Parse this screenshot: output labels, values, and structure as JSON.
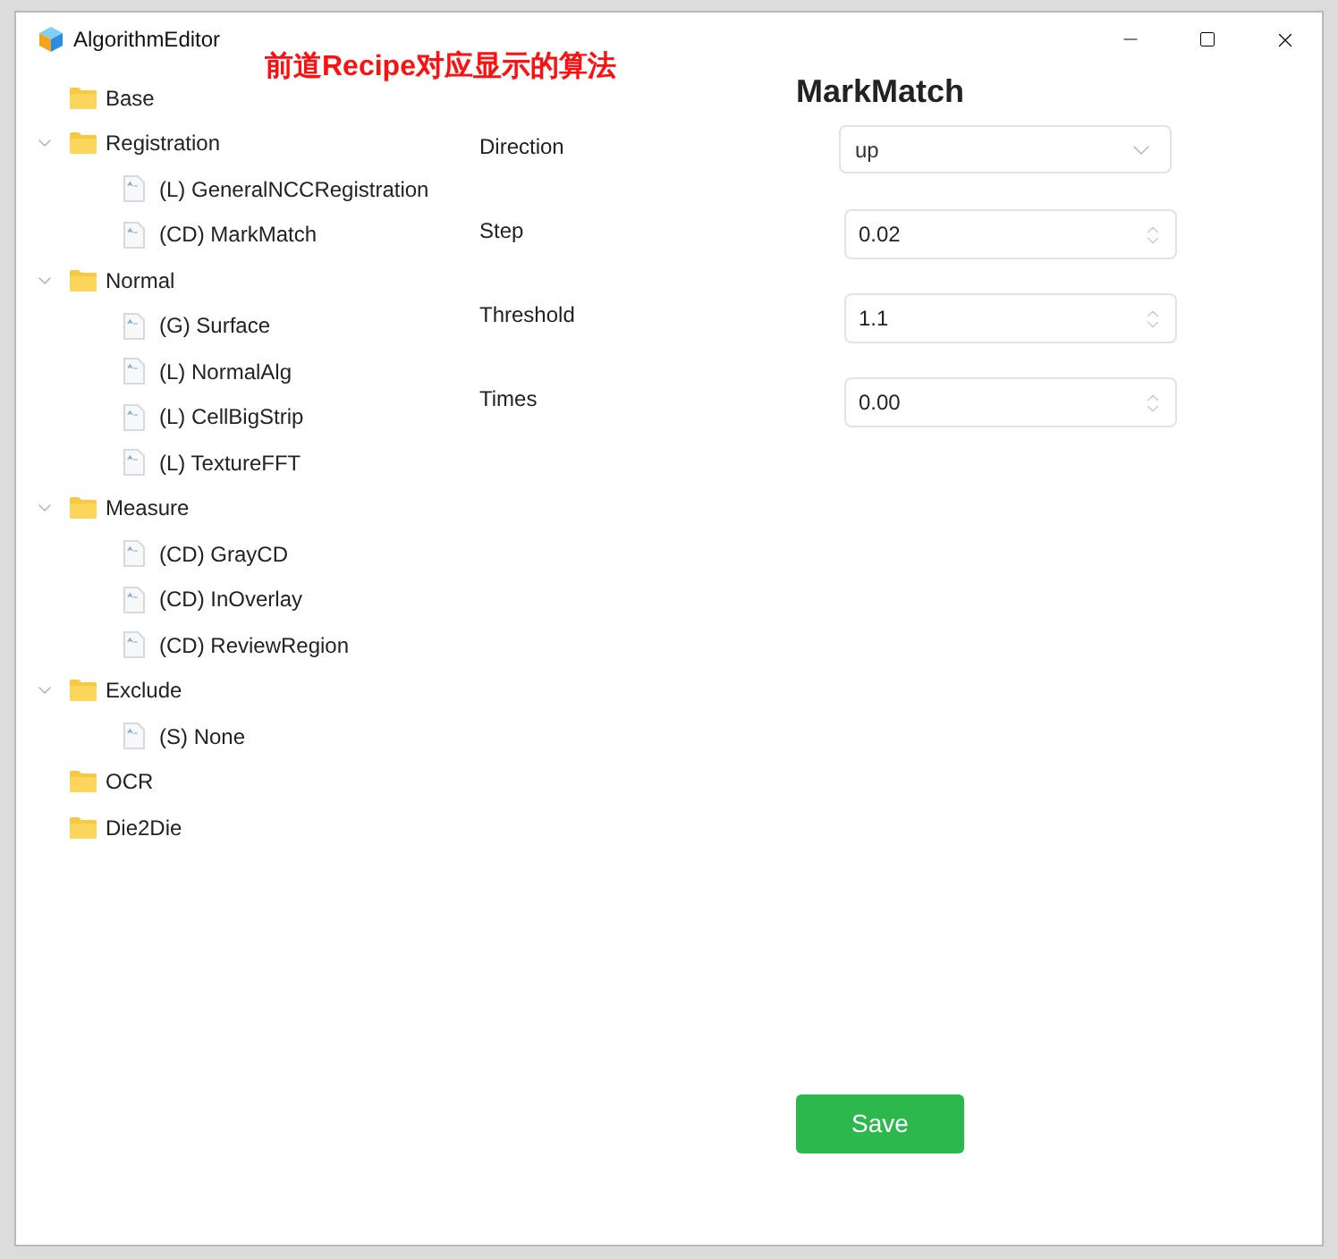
{
  "window": {
    "title": "AlgorithmEditor"
  },
  "annotation": "前道Recipe对应显示的算法",
  "tree": [
    {
      "label": "Base",
      "kind": "folder",
      "expanded": false
    },
    {
      "label": "Registration",
      "kind": "folder",
      "expanded": true,
      "children": [
        {
          "label": "(L) GeneralNCCRegistration",
          "kind": "file"
        },
        {
          "label": "(CD) MarkMatch",
          "kind": "file"
        }
      ]
    },
    {
      "label": "Normal",
      "kind": "folder",
      "expanded": true,
      "children": [
        {
          "label": "(G) Surface",
          "kind": "file"
        },
        {
          "label": "(L) NormalAlg",
          "kind": "file"
        },
        {
          "label": "(L) CellBigStrip",
          "kind": "file"
        },
        {
          "label": "(L) TextureFFT",
          "kind": "file"
        }
      ]
    },
    {
      "label": "Measure",
      "kind": "folder",
      "expanded": true,
      "children": [
        {
          "label": "(CD) GrayCD",
          "kind": "file"
        },
        {
          "label": "(CD) InOverlay",
          "kind": "file"
        },
        {
          "label": "(CD) ReviewRegion",
          "kind": "file"
        }
      ]
    },
    {
      "label": "Exclude",
      "kind": "folder",
      "expanded": true,
      "children": [
        {
          "label": "(S) None",
          "kind": "file"
        }
      ]
    },
    {
      "label": "OCR",
      "kind": "folder",
      "expanded": false
    },
    {
      "label": "Die2Die",
      "kind": "folder",
      "expanded": false
    }
  ],
  "panel": {
    "title": "MarkMatch",
    "fields": [
      {
        "label": "Direction",
        "kind": "select",
        "value": "up"
      },
      {
        "label": "Step",
        "kind": "number",
        "value": "0.02"
      },
      {
        "label": "Threshold",
        "kind": "number",
        "value": "1.1"
      },
      {
        "label": "Times",
        "kind": "number",
        "value": "0.00"
      }
    ],
    "save_button": "Save"
  }
}
